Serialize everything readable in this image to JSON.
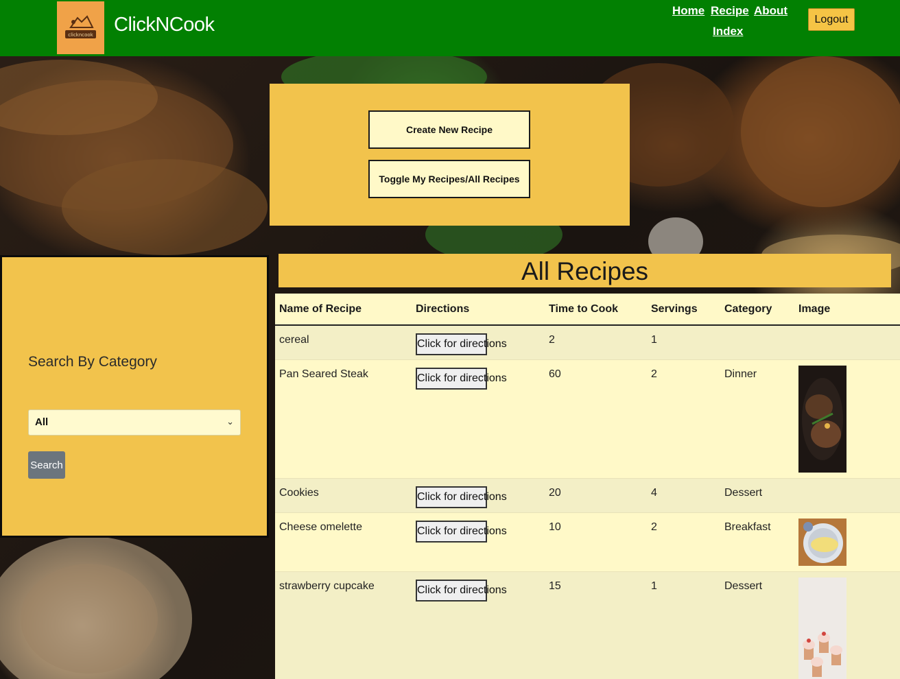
{
  "header": {
    "brand": "ClickNCook",
    "logo_text": "clickncook",
    "nav": {
      "home": "Home",
      "recipe_index_line1": "Recipe",
      "recipe_index_line2": "Index",
      "about": "About"
    },
    "logout_label": "Logout"
  },
  "actions": {
    "create_label": "Create New Recipe",
    "toggle_label": "Toggle My Recipes/All Recipes"
  },
  "search": {
    "title": "Search By Category",
    "selected_option": "All",
    "button_label": "Search"
  },
  "recipes": {
    "title": "All Recipes",
    "columns": [
      "Name of Recipe",
      "Directions",
      "Time to Cook",
      "Servings",
      "Category",
      "Image"
    ],
    "directions_label": "Click for directions",
    "rows": [
      {
        "name": "cereal",
        "time": "2",
        "servings": "1",
        "category": "",
        "image": ""
      },
      {
        "name": "Pan Seared Steak",
        "time": "60",
        "servings": "2",
        "category": "Dinner",
        "image": "steak-photo"
      },
      {
        "name": "Cookies",
        "time": "20",
        "servings": "4",
        "category": "Dessert",
        "image": ""
      },
      {
        "name": "Cheese omelette",
        "time": "10",
        "servings": "2",
        "category": "Breakfast",
        "image": "omelette-photo"
      },
      {
        "name": "strawberry cupcake",
        "time": "15",
        "servings": "1",
        "category": "Dessert",
        "image": "cupcake-photo"
      }
    ]
  },
  "colors": {
    "header_green": "#028002",
    "panel_yellow": "#f2c34c",
    "table_cream": "#fff9c8",
    "logo_orange": "#f0a248"
  }
}
